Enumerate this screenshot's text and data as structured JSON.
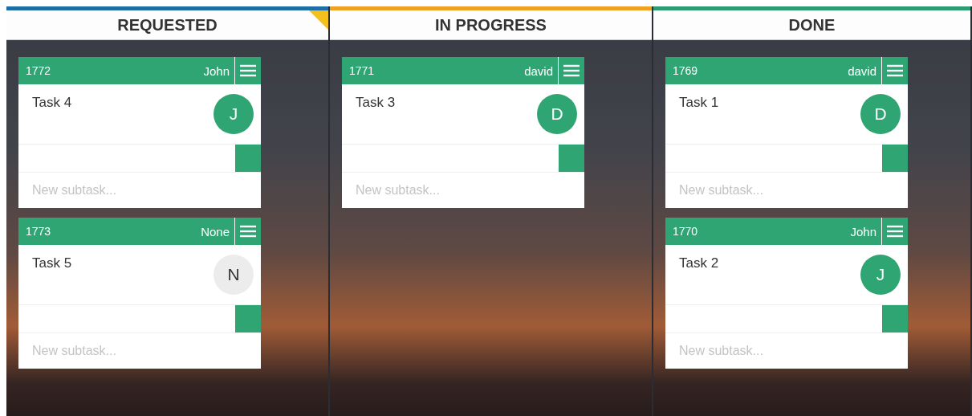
{
  "columns": [
    {
      "title": "REQUESTED",
      "color": "#1f6fa6",
      "flagged": true,
      "cards": [
        {
          "id": "1772",
          "assignee": "John",
          "title": "Task 4",
          "initial": "J",
          "assigned": true,
          "placeholder": "New subtask..."
        },
        {
          "id": "1773",
          "assignee": "None",
          "title": "Task 5",
          "initial": "N",
          "assigned": false,
          "placeholder": "New subtask..."
        }
      ]
    },
    {
      "title": "IN PROGRESS",
      "color": "#f0a11f",
      "flagged": false,
      "cards": [
        {
          "id": "1771",
          "assignee": "david",
          "title": "Task 3",
          "initial": "D",
          "assigned": true,
          "placeholder": "New subtask..."
        }
      ]
    },
    {
      "title": "DONE",
      "color": "#2e9c72",
      "flagged": false,
      "cards": [
        {
          "id": "1769",
          "assignee": "david",
          "title": "Task 1",
          "initial": "D",
          "assigned": true,
          "placeholder": "New subtask..."
        },
        {
          "id": "1770",
          "assignee": "John",
          "title": "Task 2",
          "initial": "J",
          "assigned": true,
          "placeholder": "New subtask..."
        }
      ]
    }
  ]
}
